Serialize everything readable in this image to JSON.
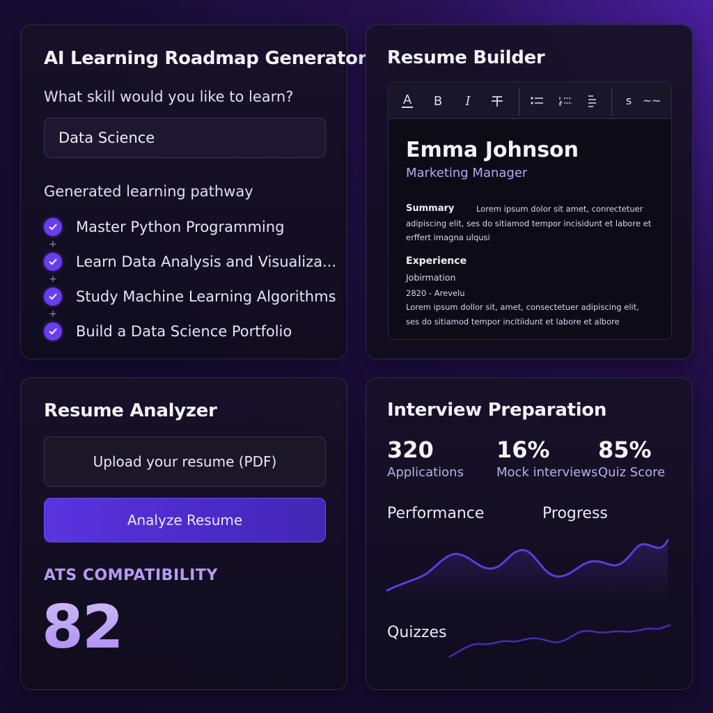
{
  "roadmap": {
    "title": "AI Learning Roadmap Generator",
    "question": "What skill would you like to learn?",
    "skill_input": {
      "value": "Data Science"
    },
    "pathway_heading": "Generated learning pathway",
    "steps": [
      {
        "label": "Master Python Programming",
        "completed": true
      },
      {
        "label": "Learn Data Analysis and Visualiza...",
        "completed": true
      },
      {
        "label": "Study Machine Learning Algorithms",
        "completed": true
      },
      {
        "label": "Build a Data Science Portfolio",
        "completed": true
      }
    ]
  },
  "builder": {
    "title": "Resume Builder",
    "toolbar": {
      "icons": [
        "text-color-icon",
        "bold-icon",
        "italic-icon",
        "strikethrough-icon",
        "bullet-list-icon",
        "numbered-list-icon",
        "align-icon",
        "strike-s-icon",
        "more-icon"
      ],
      "strike_s_label": "s",
      "more_label": "~~"
    },
    "document": {
      "name": "Emma Johnson",
      "role": "Marketing Manager",
      "summary_heading": "Summary",
      "summary_line1": "Lorem ipsum dolor sit amet, conrectetuer",
      "summary_line2": "adipiscing elit, ses  do sitiamod tempor incisidunt et labore et",
      "summary_line3": "erffert imagna ulqusi",
      "experience_heading": "Experience",
      "job_title": "Jobirmation",
      "job_dates": "2820  - Arevelu",
      "exp_line1": "Lorem ipsum dollor sit, amet,  consectetuer adipiscing elit,",
      "exp_line2": "ses do sitiamod tempor incitiidunt et labore et albore"
    }
  },
  "analyzer": {
    "title": "Resume Analyzer",
    "upload_label": "Upload your resume (PDF)",
    "analyze_label": "Analyze Resume",
    "ats_label": "ATS COMPATIBILITY",
    "ats_score": "82"
  },
  "interview": {
    "title": "Interview Preparation",
    "stats": [
      {
        "value": "320",
        "label": "Applications"
      },
      {
        "value": "16%",
        "label": "Mock interviews"
      },
      {
        "value": "85%",
        "label": "Quiz Score"
      }
    ],
    "performance_label": "Performance",
    "progress_label": "Progress",
    "quizzes_label": "Quizzes",
    "colors": {
      "performance_line": "#5a3de0",
      "quizzes_line": "#4a2ab4"
    }
  },
  "colors": {
    "accent": "#6a3df0",
    "ats_score": "#c3a6f6"
  }
}
